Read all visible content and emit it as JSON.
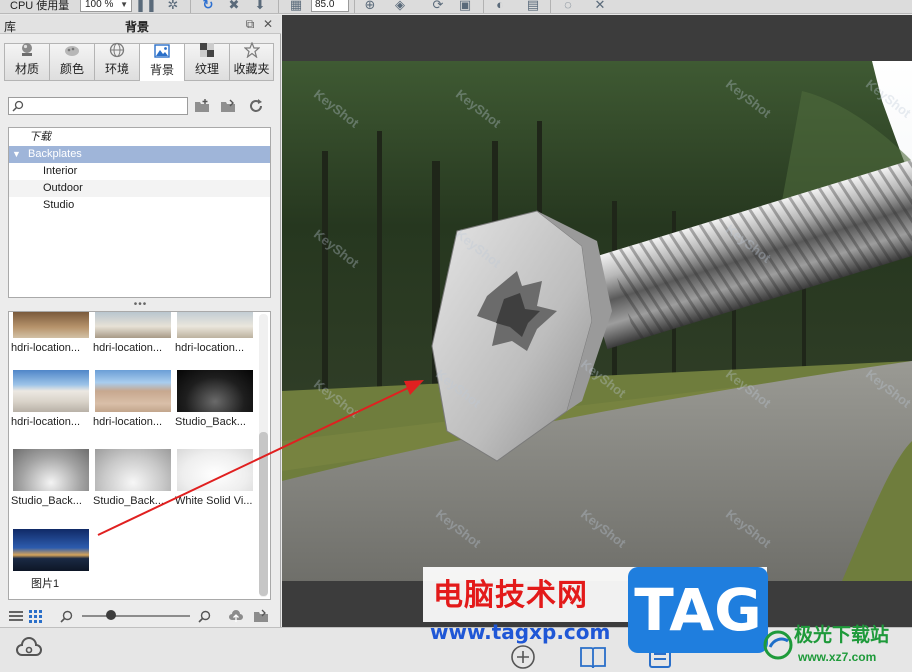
{
  "toolbar": {
    "cpu_label": "CPU 使用量",
    "cpu_value": "100 %",
    "zoom_value": "85.0"
  },
  "panel": {
    "library_label": "库",
    "title": "背景",
    "tabs": [
      {
        "label": "材质",
        "icon": "material-ball-icon"
      },
      {
        "label": "颜色",
        "icon": "color-icon"
      },
      {
        "label": "环境",
        "icon": "globe-icon"
      },
      {
        "label": "背景",
        "icon": "picture-icon"
      },
      {
        "label": "纹理",
        "icon": "checker-icon"
      },
      {
        "label": "收藏夹",
        "icon": "star-icon"
      }
    ],
    "search_placeholder": "",
    "tree": [
      {
        "label": "下载",
        "indent": 1
      },
      {
        "label": "Backplates",
        "indent": 1,
        "selected": true,
        "expanded": true
      },
      {
        "label": "Interior",
        "indent": 2
      },
      {
        "label": "Outdoor",
        "indent": 2
      },
      {
        "label": "Studio",
        "indent": 2
      }
    ],
    "thumbnails": [
      {
        "caption": "hdri-location...",
        "tone": "wood"
      },
      {
        "caption": "hdri-location...",
        "tone": "room"
      },
      {
        "caption": "hdri-location...",
        "tone": "room2"
      },
      {
        "caption": "hdri-location...",
        "tone": "street"
      },
      {
        "caption": "hdri-location...",
        "tone": "plaza"
      },
      {
        "caption": "Studio_Back...",
        "tone": "dark"
      },
      {
        "caption": "Studio_Back...",
        "tone": "grey1"
      },
      {
        "caption": "Studio_Back...",
        "tone": "grey2"
      },
      {
        "caption": "White Solid Vi...",
        "tone": "white"
      },
      {
        "caption": "图片1",
        "tone": "night"
      }
    ]
  },
  "viewport": {
    "watermark_text": "KeyShot"
  },
  "overlay": {
    "brand_title": "电脑技术网",
    "brand_url": "www.tagxp.com",
    "tag_text": "TAG",
    "site_name": "极光下载站",
    "site_url": "www.xz7.com"
  },
  "colors": {
    "selection": "#9fb5d9",
    "tag_blue": "#1f7ede",
    "brand_red": "#e31a1a",
    "arrow_red": "#e02020"
  }
}
